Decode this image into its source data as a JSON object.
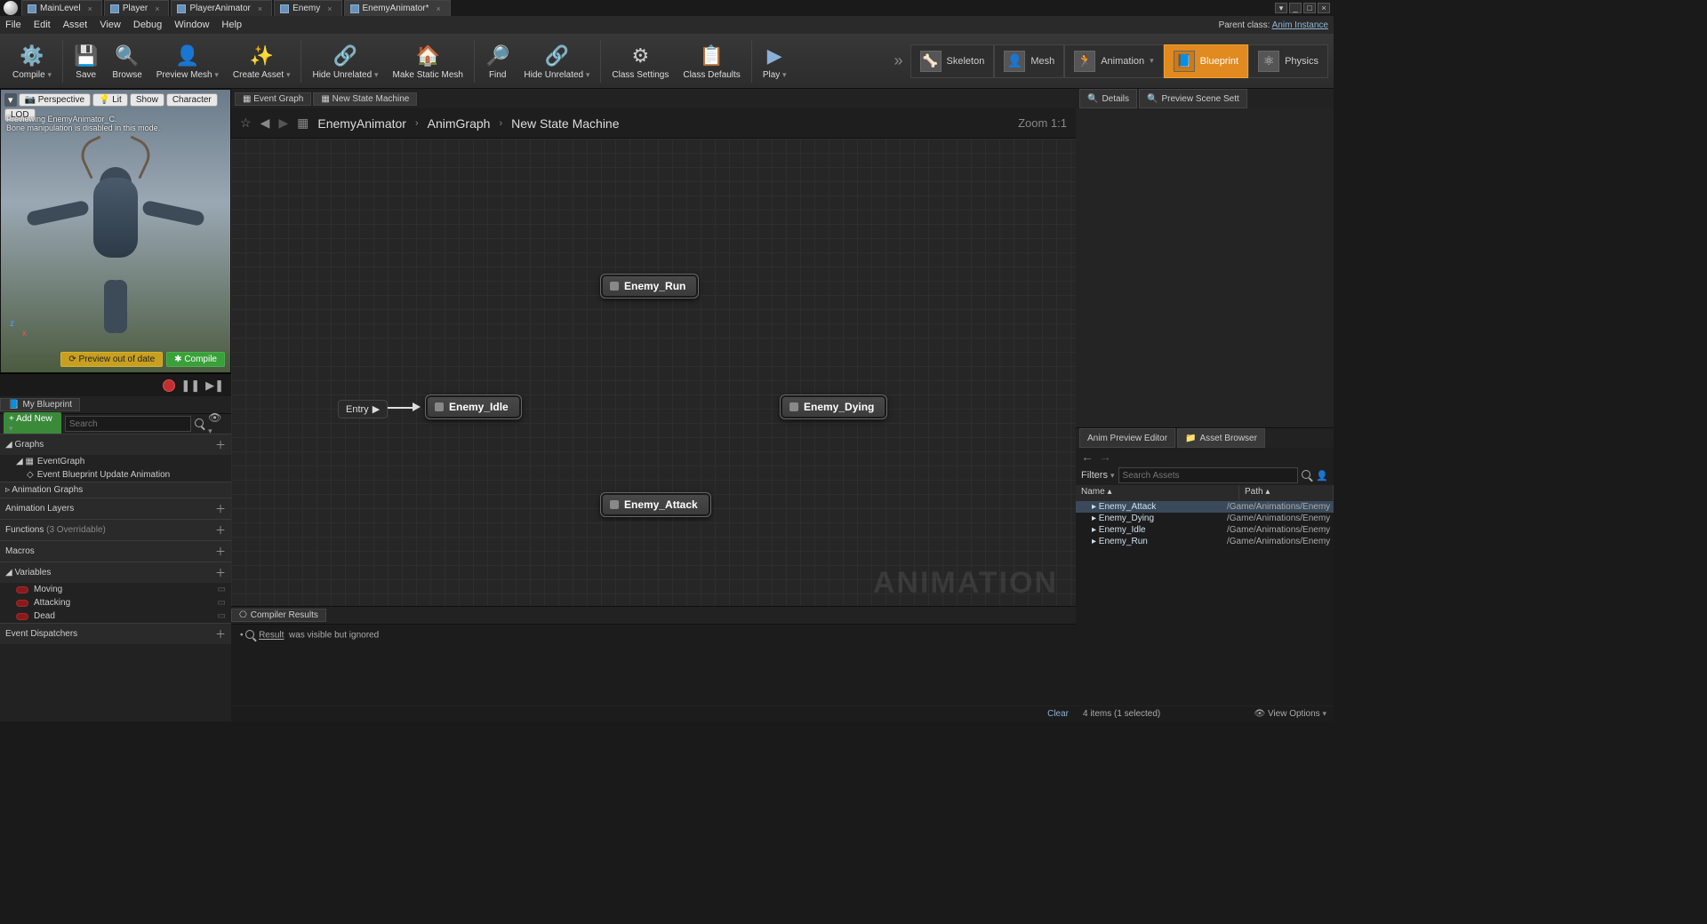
{
  "document_tabs": [
    {
      "label": "MainLevel",
      "active": false
    },
    {
      "label": "Player",
      "active": false
    },
    {
      "label": "PlayerAnimator",
      "active": false
    },
    {
      "label": "Enemy",
      "active": false
    },
    {
      "label": "EnemyAnimator*",
      "active": true
    }
  ],
  "menubar": {
    "File": "File",
    "Edit": "Edit",
    "Asset": "Asset",
    "View": "View",
    "Debug": "Debug",
    "Window": "Window",
    "Help": "Help"
  },
  "parent_class_label": "Parent class:",
  "parent_class_value": "Anim Instance",
  "toolbar": {
    "Compile": "Compile",
    "Save": "Save",
    "Browse": "Browse",
    "PreviewMesh": "Preview Mesh",
    "CreateAsset": "Create Asset",
    "HideUnrelated": "Hide Unrelated",
    "MakeStaticMesh": "Make Static Mesh",
    "Find": "Find",
    "HideUnrelated2": "Hide Unrelated",
    "ClassSettings": "Class Settings",
    "ClassDefaults": "Class Defaults",
    "Play": "Play"
  },
  "modes": {
    "Skeleton": "Skeleton",
    "Mesh": "Mesh",
    "Animation": "Animation",
    "Blueprint": "Blueprint",
    "Physics": "Physics"
  },
  "viewport": {
    "Perspective": "Perspective",
    "Lit": "Lit",
    "Show": "Show",
    "Character": "Character",
    "LOD": "LOD",
    "preview_line": "Previewing EnemyAnimator_C.",
    "bone_line": "Bone manipulation is disabled in this mode.",
    "PreviewOOD": "Preview out of date",
    "Compile": "Compile",
    "axis_z": "z",
    "axis_x": "x"
  },
  "mybp": {
    "tab": "My Blueprint",
    "AddNew": "Add New",
    "search_ph": "Search",
    "Graphs": "Graphs",
    "EventGraph": "EventGraph",
    "EventBlueprintUpdate": "Event Blueprint Update Animation",
    "AnimGraphs": "Animation Graphs",
    "AnimLayers": "Animation Layers",
    "Functions": "Functions",
    "FunctionsHint": "(3 Overridable)",
    "Macros": "Macros",
    "Variables": "Variables",
    "vars": [
      "Moving",
      "Attacking",
      "Dead"
    ],
    "EventDisp": "Event Dispatchers"
  },
  "graph_tabs": [
    {
      "label": "Event Graph",
      "active": false
    },
    {
      "label": "New State Machine",
      "active": true
    }
  ],
  "breadcrumb": {
    "root": "EnemyAnimator",
    "mid": "AnimGraph",
    "leaf": "New State Machine"
  },
  "zoom": "Zoom 1:1",
  "states": {
    "Entry": "Entry",
    "Idle": "Enemy_Idle",
    "Run": "Enemy_Run",
    "Dying": "Enemy_Dying",
    "Attack": "Enemy_Attack"
  },
  "watermark": "ANIMATION",
  "compiler": {
    "tab": "Compiler Results",
    "Result": "Result",
    "msg": "was visible but ignored",
    "Clear": "Clear"
  },
  "right_tabs": {
    "Details": "Details",
    "PreviewScene": "Preview Scene Sett"
  },
  "right_tabs2": {
    "AnimPreview": "Anim Preview Editor",
    "AssetBrowser": "Asset Browser"
  },
  "asset_browser": {
    "Filters": "Filters",
    "search_ph": "Search Assets",
    "col_name": "Name",
    "col_path": "Path",
    "rows": [
      {
        "name": "Enemy_Attack",
        "path": "/Game/Animations/Enemy",
        "sel": true
      },
      {
        "name": "Enemy_Dying",
        "path": "/Game/Animations/Enemy",
        "sel": false
      },
      {
        "name": "Enemy_Idle",
        "path": "/Game/Animations/Enemy",
        "sel": false
      },
      {
        "name": "Enemy_Run",
        "path": "/Game/Animations/Enemy",
        "sel": false
      }
    ],
    "footer_count": "4 items (1 selected)",
    "ViewOptions": "View Options"
  }
}
